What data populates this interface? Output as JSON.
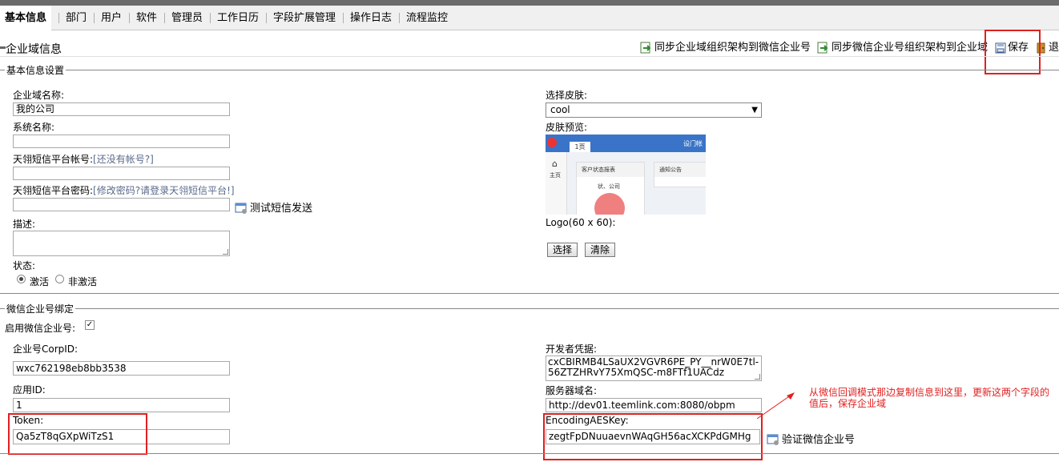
{
  "tabs": [
    {
      "label": "基本信息",
      "active": true
    },
    {
      "label": "部门"
    },
    {
      "label": "用户"
    },
    {
      "label": "软件"
    },
    {
      "label": "管理员"
    },
    {
      "label": "工作日历"
    },
    {
      "label": "字段扩展管理"
    },
    {
      "label": "操作日志"
    },
    {
      "label": "流程监控"
    }
  ],
  "header": {
    "title": "企业域信息",
    "sync_to_wechat": "同步企业域组织架构到微信企业号",
    "sync_from_wechat": "同步微信企业号组织架构到企业域",
    "save": "保存",
    "exit": "退"
  },
  "basic": {
    "legend": "基本信息设置",
    "domain_name_label": "企业域名称:",
    "domain_name_value": "我的公司",
    "system_name_label": "系统名称:",
    "system_name_value": "",
    "sms_account_label": "天翎短信平台帐号:",
    "sms_account_link": "[还没有帐号?]",
    "sms_account_value": "",
    "sms_password_label": "天翎短信平台密码:",
    "sms_password_link": "[修改密码?请登录天翎短信平台!]",
    "sms_password_value": "",
    "test_sms": "测试短信发送",
    "desc_label": "描述:",
    "desc_value": "",
    "status_label": "状态:",
    "status_active": "激活",
    "status_inactive": "非激活",
    "skin_label": "选择皮肤:",
    "skin_value": "cool",
    "preview_label": "皮肤预览:",
    "logo_label": "Logo(60 x 60):",
    "choose_btn": "选择",
    "clear_btn": "清除"
  },
  "preview": {
    "tab": "1页",
    "right": "设门帐",
    "panel1": "客户状态报表",
    "panel2": "通知公告",
    "home": "主页",
    "legend_text": "状、公司"
  },
  "wechat": {
    "legend": "微信企业号绑定",
    "enable_label": "启用微信企业号:",
    "corpid_label": "企业号CorpID:",
    "corpid_value": "wxc762198eb8bb3538",
    "appid_label": "应用ID:",
    "appid_value": "1",
    "token_label": "Token:",
    "token_value": "Qa5zT8qGXpWiTzS1",
    "secret_label": "开发者凭据:",
    "secret_value": "cxCBIRMB4LSaUX2VGVR6PE_PY__nrW0E7tl-56ZTZHRvY75XmQSC-m8FTf1UACdz",
    "server_label": "服务器域名:",
    "server_value": "http://dev01.teemlink.com:8080/obpm",
    "aeskey_label": "EncodingAESKey:",
    "aeskey_value": "zegtFpDNuuaevnWAqGH56acXCKPdGMHg",
    "verify": "验证微信企业号"
  },
  "annotation": "从微信回调模式那边复制信息到这里，更新这两个字段的值后，保存企业域",
  "colors": {
    "highlight": "#e02020",
    "tabbar": "#f0f0f0",
    "link": "#5a6a8a"
  }
}
